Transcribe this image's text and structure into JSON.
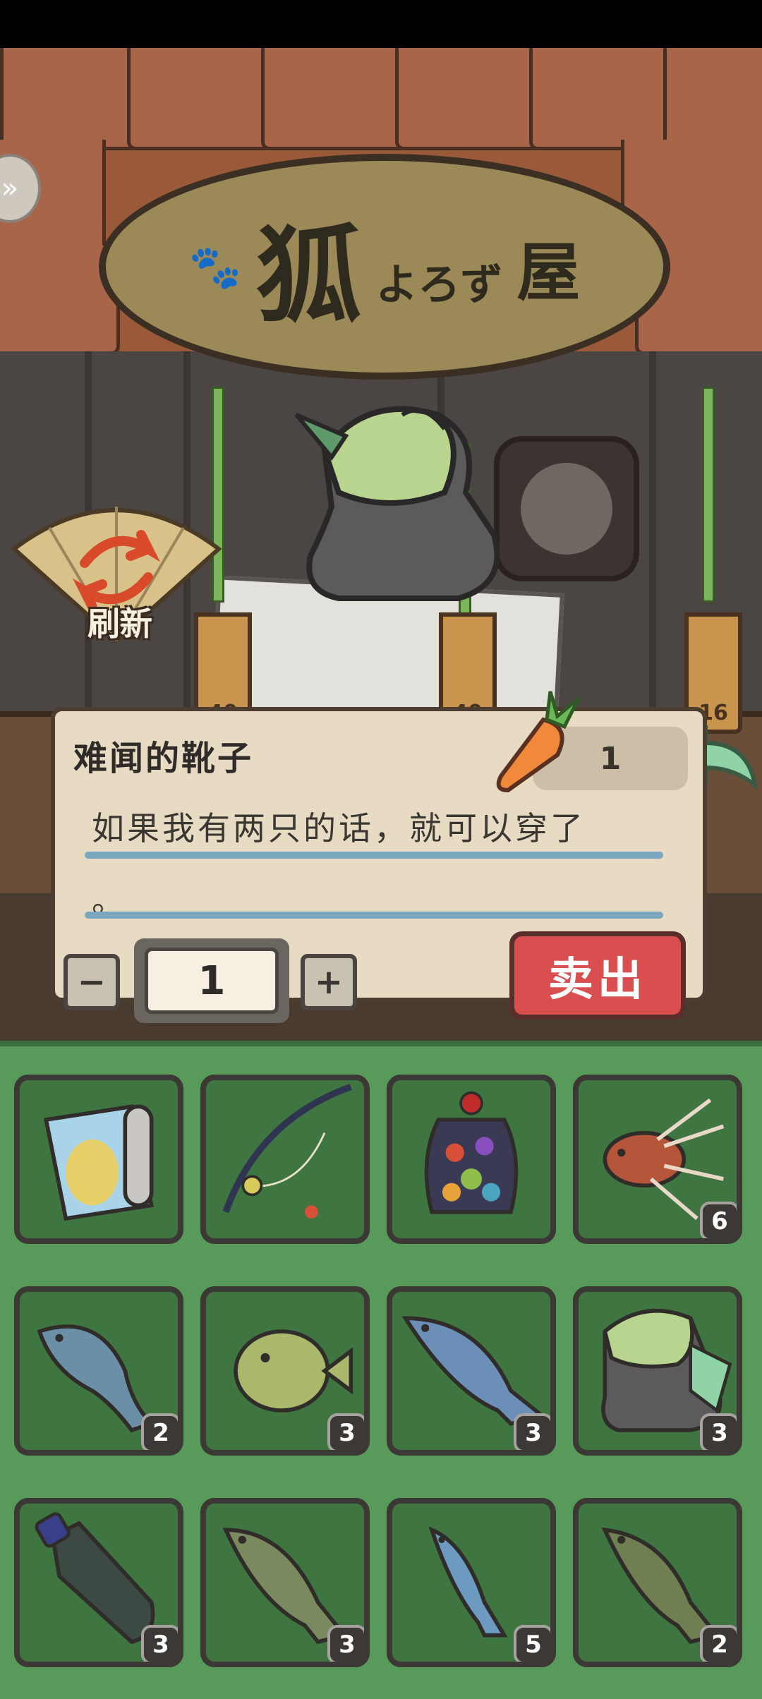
{
  "shop": {
    "sign_main": "狐",
    "sign_kana": "よろず",
    "sign_house": "屋",
    "refresh_label": "刷新",
    "tag_prices": [
      "40",
      "40",
      "16"
    ]
  },
  "item_panel": {
    "name": "难闻的靴子",
    "price": "1",
    "description_line1": "如果我有两只的话，就可以穿了",
    "description_line2": "。",
    "minus_label": "−",
    "quantity": "1",
    "plus_label": "+",
    "sell_label": "卖出"
  },
  "inventory": {
    "items": [
      {
        "name": "map",
        "count": ""
      },
      {
        "name": "fishing-rod",
        "count": ""
      },
      {
        "name": "fruit-jar",
        "count": ""
      },
      {
        "name": "lionfish",
        "count": "6"
      },
      {
        "name": "fish-blue",
        "count": "2"
      },
      {
        "name": "pufferfish",
        "count": "3"
      },
      {
        "name": "salmon",
        "count": "3"
      },
      {
        "name": "smelly-boot",
        "count": "3"
      },
      {
        "name": "plastic-bottle",
        "count": "3"
      },
      {
        "name": "bass",
        "count": "3"
      },
      {
        "name": "small-fish",
        "count": "5"
      },
      {
        "name": "green-fish",
        "count": "2"
      }
    ]
  },
  "colors": {
    "panel_bg": "#e7dbc3",
    "sell_button": "#d94f4f",
    "inventory_bg": "#579a59",
    "slot_bg": "#3f7540"
  }
}
